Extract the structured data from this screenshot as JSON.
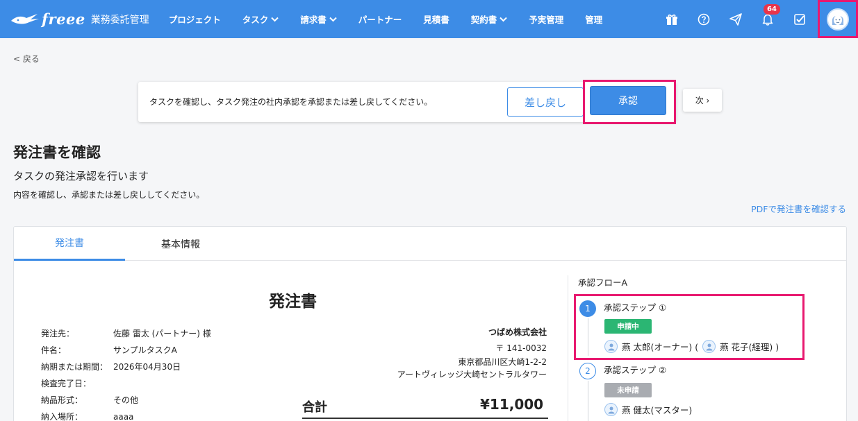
{
  "header": {
    "logo_text": "freee",
    "logo_sub": "業務委託管理",
    "nav": [
      {
        "label": "プロジェクト",
        "has_menu": false
      },
      {
        "label": "タスク",
        "has_menu": true
      },
      {
        "label": "請求書",
        "has_menu": true
      },
      {
        "label": "パートナー",
        "has_menu": false
      },
      {
        "label": "見積書",
        "has_menu": false
      },
      {
        "label": "契約書",
        "has_menu": true
      },
      {
        "label": "予実管理",
        "has_menu": false
      },
      {
        "label": "管理",
        "has_menu": false
      }
    ],
    "notification_count": "64",
    "icons": [
      "gift-icon",
      "help-icon",
      "send-icon",
      "bell-icon",
      "checkbox-icon",
      "avatar"
    ],
    "brand_color": "#3d8ce6"
  },
  "back_label": "< 戻る",
  "approval_bar": {
    "message": "タスクを確認し、タスク発注の社内承認を承認または差し戻してください。",
    "reject_label": "差し戻し",
    "approve_label": "承認",
    "next_label": "次 ›"
  },
  "page": {
    "title": "発注書を確認",
    "subtitle": "タスクの発注承認を行います",
    "description": "内容を確認し、承認または差し戻ししてください。",
    "pdf_link": "PDFで発注書を確認する"
  },
  "tabs": [
    {
      "label": "発注書",
      "active": true
    },
    {
      "label": "基本情報",
      "active": false
    }
  ],
  "document": {
    "title": "発注書",
    "fields": [
      {
        "key": "発注先：",
        "value": "佐藤 雷太 (パートナー) 様"
      },
      {
        "key": "件名：",
        "value": "サンプルタスクA"
      },
      {
        "key": "納期または期間：",
        "value": "2026年04月30日"
      },
      {
        "key": "検査完了日：",
        "value": ""
      },
      {
        "key": "納品形式：",
        "value": "その他"
      },
      {
        "key": "納入場所：",
        "value": "aaaa"
      }
    ],
    "company": {
      "name": "つばめ株式会社",
      "postal": "〒 141-0032",
      "address1": "東京都品川区大崎1-2-2",
      "address2": "アートヴィレッジ大崎セントラルタワー"
    },
    "total_label": "合計",
    "total_value": "¥11,000"
  },
  "approval_flow": {
    "title": "承認フローA",
    "steps": [
      {
        "number": "1",
        "label": "承認ステップ ①",
        "status": "申請中",
        "status_color": "#2bb673",
        "approvers": [
          "燕 太郎(オーナー) (",
          "燕 花子(経理) )"
        ]
      },
      {
        "number": "2",
        "label": "承認ステップ ②",
        "status": "未申請",
        "status_color": "#a9acb1",
        "approvers": [
          "燕 健太(マスター)"
        ]
      }
    ]
  }
}
